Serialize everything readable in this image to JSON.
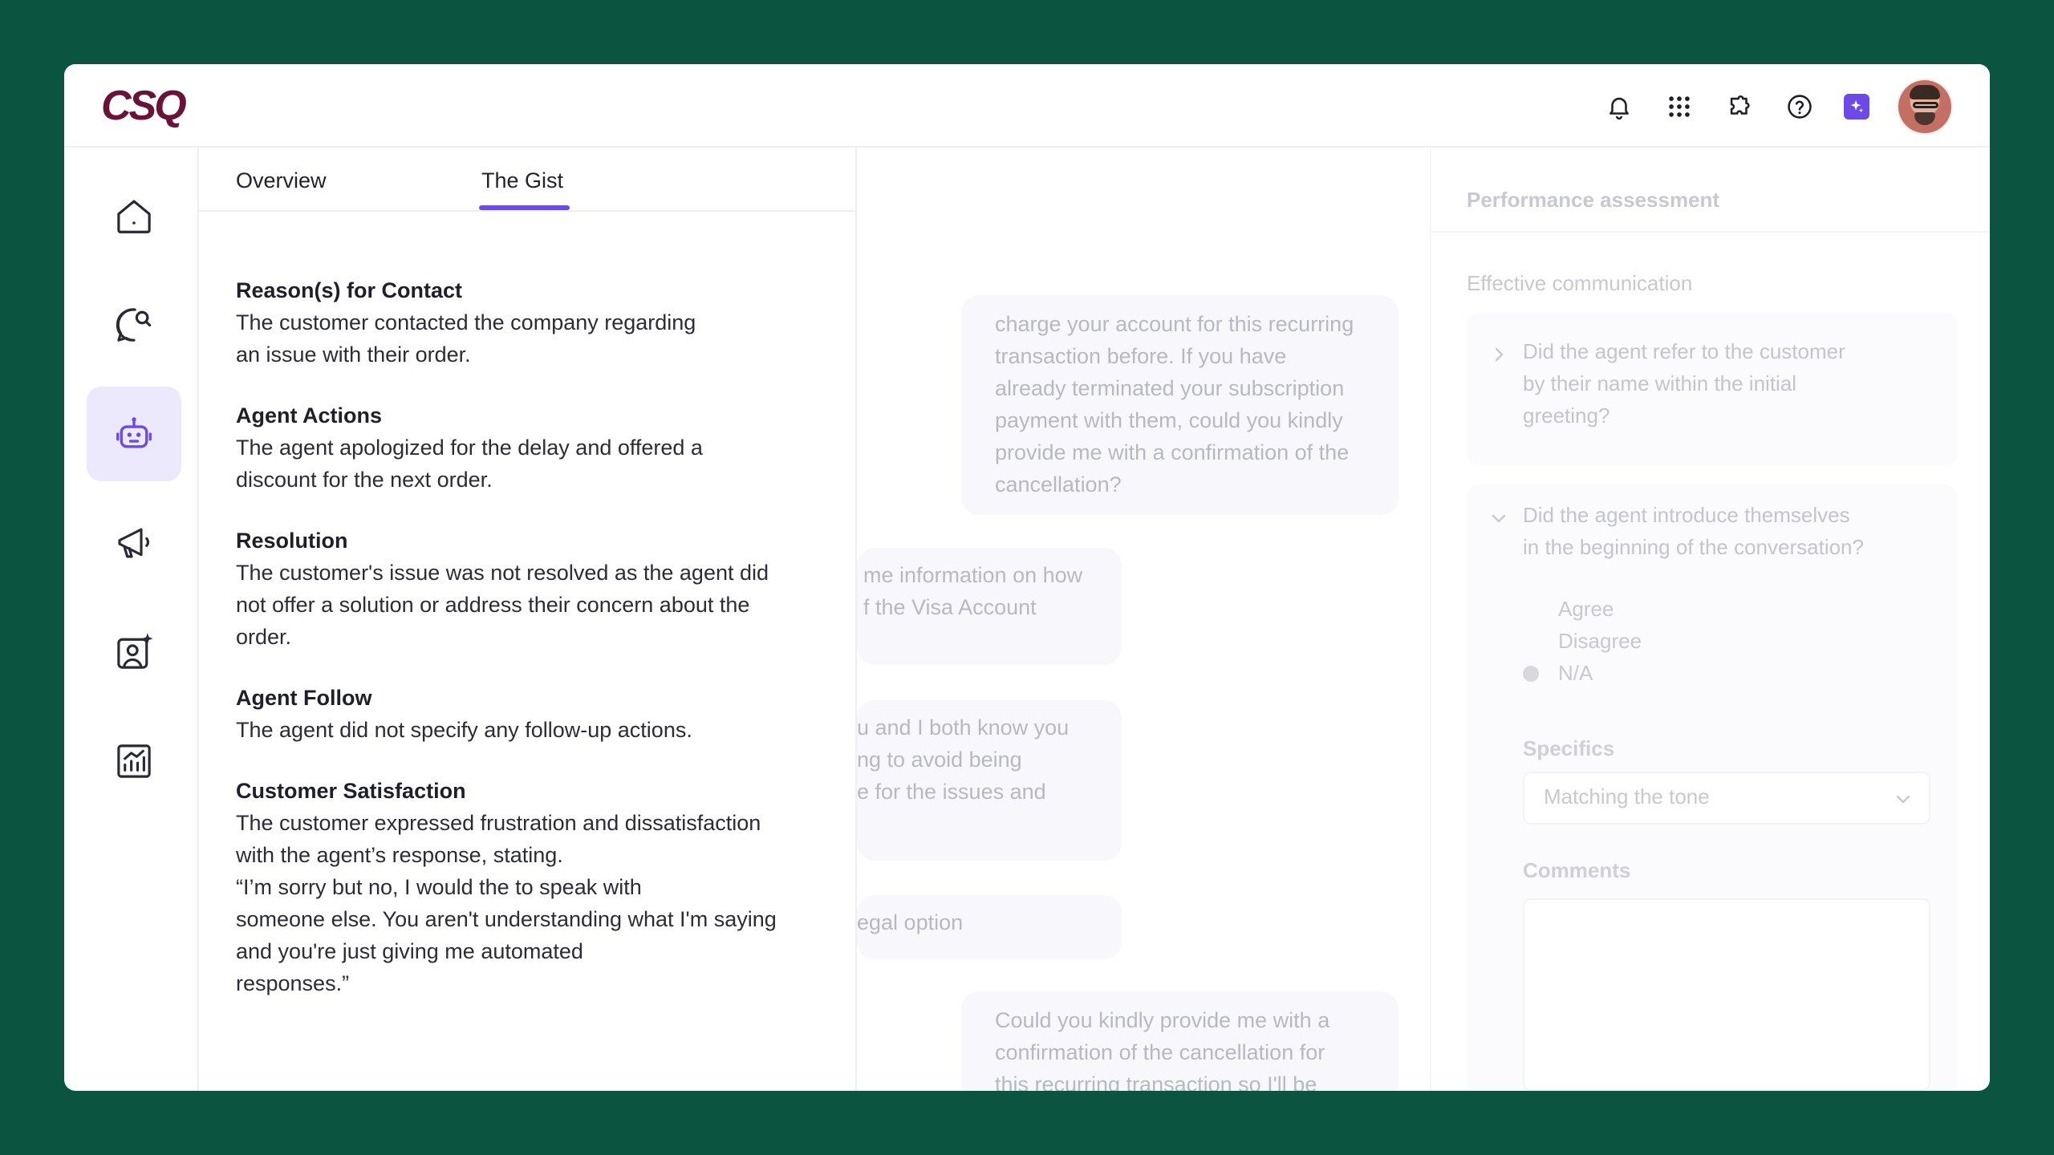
{
  "app": {
    "logo_text": "CSQ"
  },
  "topbar": {
    "icons": [
      "bell-icon",
      "apps-grid-icon",
      "puzzle-icon",
      "help-icon",
      "sparkle-icon"
    ],
    "colors": {
      "accent": "#6d4ae8",
      "logo": "#6b1238",
      "background": "#0a5440"
    }
  },
  "sidebar": {
    "items": [
      {
        "icon": "home-icon",
        "active": false
      },
      {
        "icon": "chat-search-icon",
        "active": false
      },
      {
        "icon": "robot-icon",
        "active": true
      },
      {
        "icon": "megaphone-icon",
        "active": false
      },
      {
        "icon": "user-sparkle-icon",
        "active": false
      },
      {
        "icon": "chart-icon",
        "active": false
      }
    ]
  },
  "gist": {
    "tabs": [
      {
        "label": "Overview",
        "active": false
      },
      {
        "label": "The Gist",
        "active": true
      }
    ],
    "sections": [
      {
        "title": "Reason(s) for Contact",
        "body": "The customer contacted the company regarding\nan issue with their order."
      },
      {
        "title": "Agent Actions",
        "body": "The agent apologized for the delay and offered a\ndiscount for the next order."
      },
      {
        "title": "Resolution",
        "body": "The customer's issue was not resolved as the agent did\nnot offer a solution or address their concern about the\norder."
      },
      {
        "title": "Agent Follow",
        "body": "The agent did not specify any follow-up actions."
      },
      {
        "title": "Customer Satisfaction",
        "body": "The customer expressed frustration and dissatisfaction\nwith the agent’s response, stating.\n“I’m sorry but no, I would the to speak with\nsomeone else. You aren't understanding what I'm saying\nand you're just giving me automated\nresponses.”"
      }
    ]
  },
  "conversation": {
    "bubbles": [
      "charge your account for this recurring\ntransaction before. If you have\nalready terminated your subscription\npayment with them, could you kindly\nprovide me with a confirmation of the\ncancellation?",
      " me information on how\nf the Visa Account",
      "u and I both know you\nng to avoid being\ne for the issues and",
      "egal option",
      "Could you kindly provide me with a\nconfirmation of the cancellation for\nthis recurring transaction so I'll be"
    ]
  },
  "performance": {
    "title": "Performance assessment",
    "category": "Effective communication",
    "question1": "Did the agent refer to the customer\nby their name within the initial\ngreeting?",
    "question2": "Did the agent introduce themselves\nin the beginning of the conversation?",
    "options": [
      "Agree",
      "Disagree",
      "N/A"
    ],
    "selected_option": "N/A",
    "specifics_label": "Specifics",
    "specifics_value": "Matching the tone",
    "comments_label": "Comments"
  }
}
